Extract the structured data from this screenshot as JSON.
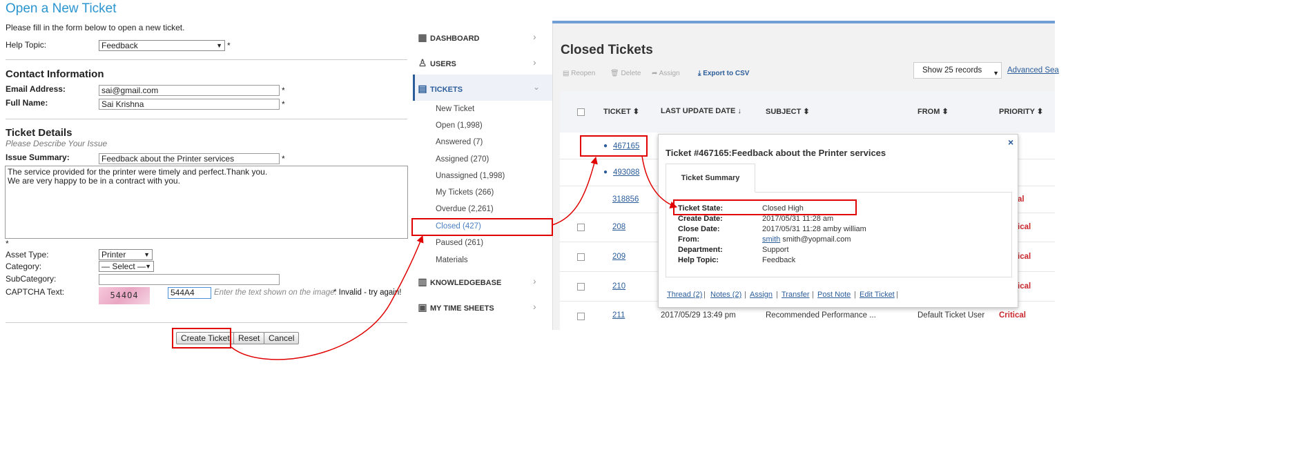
{
  "form": {
    "title": "Open a New Ticket",
    "intro": "Please fill in the form below to open a new ticket.",
    "help_topic_label": "Help Topic:",
    "help_topic_value": "Feedback",
    "contact_heading": "Contact Information",
    "email_label": "Email Address:",
    "email_value": "sai@gmail.com",
    "name_label": "Full Name:",
    "name_value": "Sai Krishna",
    "details_heading": "Ticket Details",
    "details_sub": "Please Describe Your Issue",
    "summary_label": "Issue Summary:",
    "summary_value": "Feedback about the Printer services",
    "body_line1": "The service provided for the printer were timely and perfect.Thank you.",
    "body_line2": "We are very happy to be in a contract with you.",
    "asset_label": "Asset Type:",
    "asset_value": "Printer",
    "category_label": "Category:",
    "category_value": "— Select —",
    "subcategory_label": "SubCategory:",
    "captcha_label": "CAPTCHA Text:",
    "captcha_image_text": "544O4",
    "captcha_value": "544A4",
    "captcha_hint": "Enter the text shown on the image.",
    "captcha_error": "* Invalid - try again!",
    "required_mark": "*",
    "create_label": "Create Ticket",
    "reset_label": "Reset",
    "cancel_label": "Cancel"
  },
  "sidebar": {
    "dashboard": "DASHBOARD",
    "users": "USERS",
    "tickets": "TICKETS",
    "sub_items": [
      "New Ticket",
      "Open (1,998)",
      "Answered (7)",
      "Assigned (270)",
      "Unassigned (1,998)",
      "My Tickets (266)",
      "Overdue (2,261)",
      "Closed (427)",
      "Paused (261)",
      "Materials"
    ],
    "knowledgebase": "KNOWLEDGEBASE",
    "timesheets": "MY TIME SHEETS"
  },
  "main": {
    "title": "Closed Tickets",
    "tools": [
      "Reopen",
      "Delete",
      "Assign",
      "Export to CSV"
    ],
    "show_records": "Show 25 records",
    "advanced_search": "Advanced Sea",
    "columns": [
      "TICKET",
      "LAST UPDATE DATE",
      "SUBJECT",
      "FROM",
      "PRIORITY"
    ],
    "rows": [
      {
        "ticket": "467165",
        "date": "",
        "subject": "",
        "from": "",
        "priority": ""
      },
      {
        "ticket": "493088",
        "date": "",
        "subject": "",
        "from": "",
        "priority": ""
      },
      {
        "ticket": "318856",
        "date": "",
        "subject": "",
        "from": "",
        "priority": "al"
      },
      {
        "ticket": "208",
        "date": "",
        "subject": "",
        "from": "",
        "priority": "ical"
      },
      {
        "ticket": "209",
        "date": "",
        "subject": "",
        "from": "",
        "priority": "ical"
      },
      {
        "ticket": "210",
        "date": "",
        "subject": "",
        "from": "",
        "priority": "ical"
      },
      {
        "ticket": "211",
        "date": "2017/05/29 13:49 pm",
        "subject": "Recommended Performance ...",
        "from": "Default Ticket User",
        "priority": "Critical"
      }
    ]
  },
  "popup": {
    "title": "Ticket #467165:Feedback about the Printer services",
    "close": "×",
    "tab": "Ticket Summary",
    "state_label": "Ticket State:",
    "state_value": "Closed High",
    "create_label": "Create Date:",
    "create_value": "2017/05/31 11:28 am",
    "close_label": "Close Date:",
    "close_value": "2017/05/31 11:28 amby william",
    "from_label": "From:",
    "from_link": "smith",
    "from_email": "smith@yopmail.com",
    "dept_label": "Department:",
    "dept_value": "Support",
    "topic_label": "Help Topic:",
    "topic_value": "Feedback",
    "links": [
      "Thread (2)",
      "Notes (2)",
      "Assign",
      "Transfer",
      "Post Note",
      "Edit Ticket"
    ],
    "link_sep": "|"
  },
  "colors": {
    "accent_blue": "#2a95d0",
    "link_blue": "#2a5c9a",
    "highlight_red": "#e00000",
    "critical_red": "#c9262c"
  }
}
